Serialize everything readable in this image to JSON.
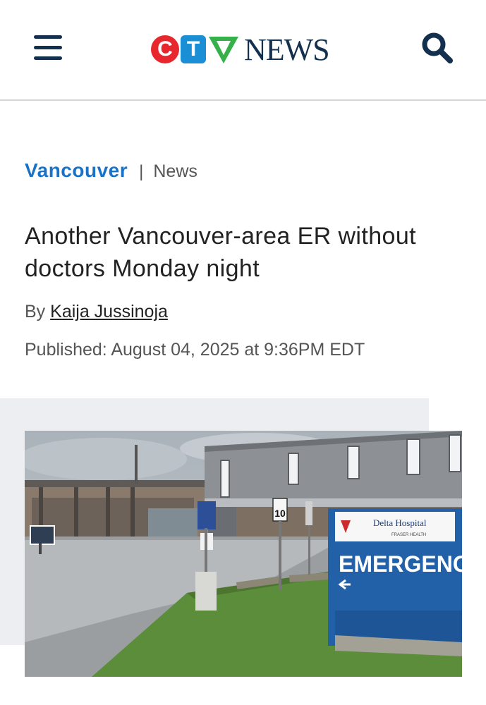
{
  "header": {
    "logo_letters": [
      "C",
      "T",
      "V"
    ],
    "logo_word": "NEWS",
    "menu_icon": "hamburger-menu-icon",
    "search_icon": "search-icon",
    "colors": {
      "navy": "#13304f",
      "red": "#e8262d",
      "blue": "#1a8fd6",
      "green": "#36b14a"
    }
  },
  "article": {
    "section": "Vancouver",
    "separator": "|",
    "subsection": "News",
    "headline": "Another Vancouver-area ER without doctors Monday night",
    "byline_prefix": "By",
    "author": "Kaija Jussinoja",
    "published": "Published: August 04, 2025 at 9:36PM EDT",
    "accent_color": "#1a72c7"
  },
  "photo": {
    "sign_hospital": "Delta Hospital",
    "sign_authority": "FRASER HEALTH",
    "sign_emergency": "EMERGENCY",
    "speed_limit": "10"
  }
}
